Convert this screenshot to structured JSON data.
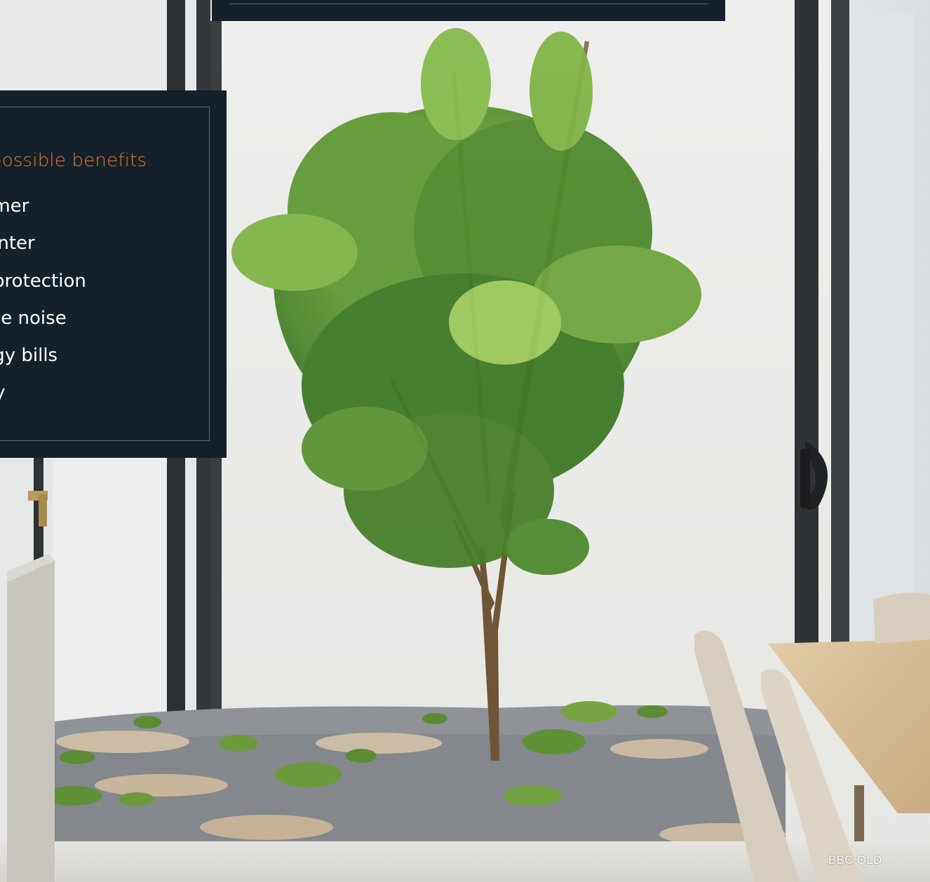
{
  "info_panel": {
    "heading": "possible benefits",
    "items": [
      "mmer",
      "Winter",
      "V protection",
      "side noise",
      "ergy bills",
      "rity"
    ]
  },
  "photo": {
    "credit": "BBC QLD"
  },
  "colors": {
    "panel_bg": "#14202a",
    "heading_accent": "#e8762a",
    "panel_border": "#5c6c78"
  }
}
